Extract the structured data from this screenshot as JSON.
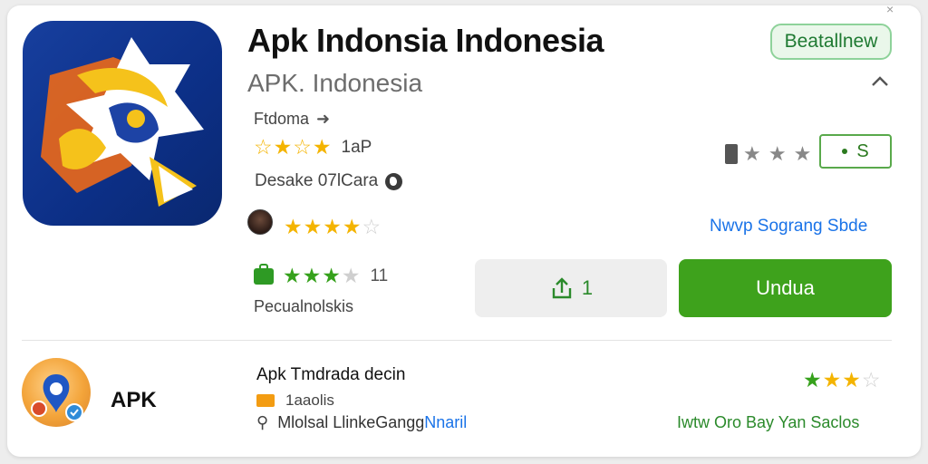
{
  "app": {
    "title": "Apk Indonsia Indonesia",
    "developer": "APK. Indonesia",
    "category": "Ftdoma",
    "rating_count": "1aP",
    "downloads_text": "Desake 07lCara",
    "review_count": "11",
    "category_label": "Pecualnolskis"
  },
  "header": {
    "badge_label": "Beatallnew",
    "price_label": "S",
    "close_label": "×"
  },
  "actions": {
    "link_label": "Nwvp Sograng Sbde",
    "share_count": "1",
    "install_label": "Undua"
  },
  "related": {
    "icon_label": "APK",
    "title": "Apk Tmdrada decin",
    "count": "1aaolis",
    "meta_text": "Mlolsal LlinkeGangg",
    "meta_link": "Nnaril",
    "footer_link": "Iwtw Oro Bay Yan Saclos"
  },
  "ratings": {
    "main_stars": 3.5,
    "reviewer_stars": 3.5,
    "green_stars": 3.5,
    "related_stars": 2.5
  },
  "colors": {
    "accent_green": "#3ea21c",
    "star_gold": "#f4b400",
    "link_blue": "#1a73e8",
    "icon_blue": "#0c2f86"
  },
  "icons": [
    "close-icon",
    "app-logo",
    "arrow-right-icon",
    "chevron-up-icon",
    "globe-icon",
    "bookmark-icon",
    "share-icon",
    "category-icon",
    "link-icon"
  ]
}
